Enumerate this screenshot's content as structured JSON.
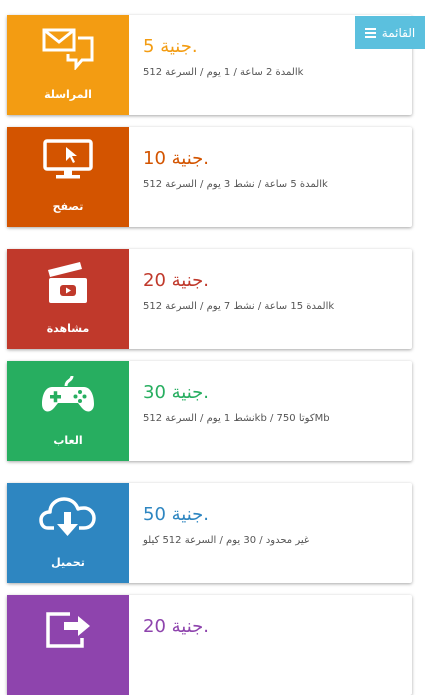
{
  "menu": {
    "label": "القائمة"
  },
  "colors": {
    "menu": "#5bc0de",
    "text_secondary": "#555555"
  },
  "packages": [
    {
      "icon": "message-icon",
      "label": "المراسلة",
      "price": "5 جنية.",
      "details": "المدة 2 ساعة / 1 يوم / السرعة 512k",
      "color": "#f39c12"
    },
    {
      "icon": "browse-monitor-icon",
      "label": "تصفح",
      "price": "10 جنية.",
      "details": "المدة 5 ساعة / نشط 3 يوم / السرعة 512k",
      "color": "#d35400"
    },
    {
      "icon": "video-clapper-icon",
      "label": "مشاهدة",
      "price": "20 جنية.",
      "details": "المدة 15 ساعة / نشط 7 يوم / السرعة 512k",
      "color": "#c0392b"
    },
    {
      "icon": "gamepad-icon",
      "label": "العاب",
      "price": "30 جنية.",
      "details": "نشط 1 يوم / السرعة 512kb / كوتا 750Mb",
      "color": "#27ae60"
    },
    {
      "icon": "cloud-download-icon",
      "label": "تحميل",
      "price": "50 جنية.",
      "details": "غير محدود / 30 يوم / السرعة 512 كيلو",
      "color": "#2e86c1"
    },
    {
      "icon": "share-arrow-icon",
      "label": "",
      "price": "20 جنية.",
      "details": "",
      "color": "#8e44ad"
    }
  ]
}
